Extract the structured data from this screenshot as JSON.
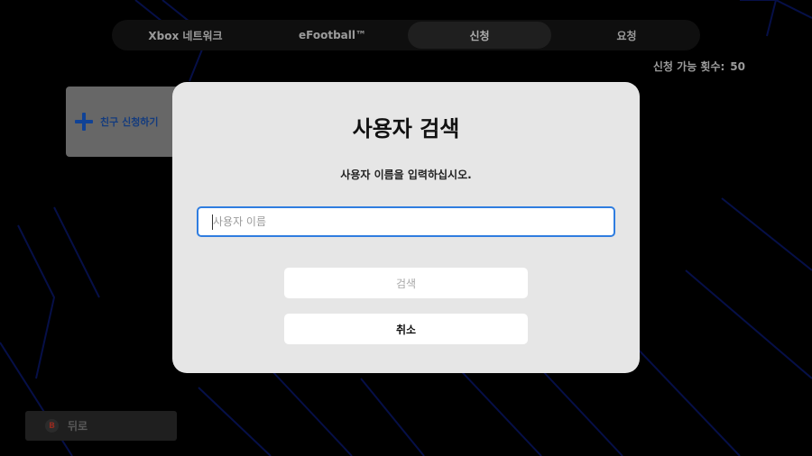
{
  "tabs": [
    {
      "label": "Xbox 네트워크",
      "active": false
    },
    {
      "label": "eFootball™",
      "active": false
    },
    {
      "label": "신청",
      "active": true
    },
    {
      "label": "요청",
      "active": false
    }
  ],
  "request_count": {
    "label": "신청 가능 횟수:",
    "value": "50"
  },
  "friend_request": {
    "label": "친구 신청하기",
    "icon": "plus-icon"
  },
  "back": {
    "label": "뒤로",
    "icon_glyph": "B"
  },
  "modal": {
    "title": "사용자 검색",
    "subtitle": "사용자 이름을 입력하십시오.",
    "input_placeholder": "사용자 이름",
    "input_value": "",
    "search_label": "검색",
    "cancel_label": "취소"
  },
  "colors": {
    "background": "#000000",
    "accent_blue": "#2f7de0",
    "modal_bg": "#e6e6e6",
    "plus_blue": "#1658c8",
    "b_button_red": "#c0392b"
  }
}
